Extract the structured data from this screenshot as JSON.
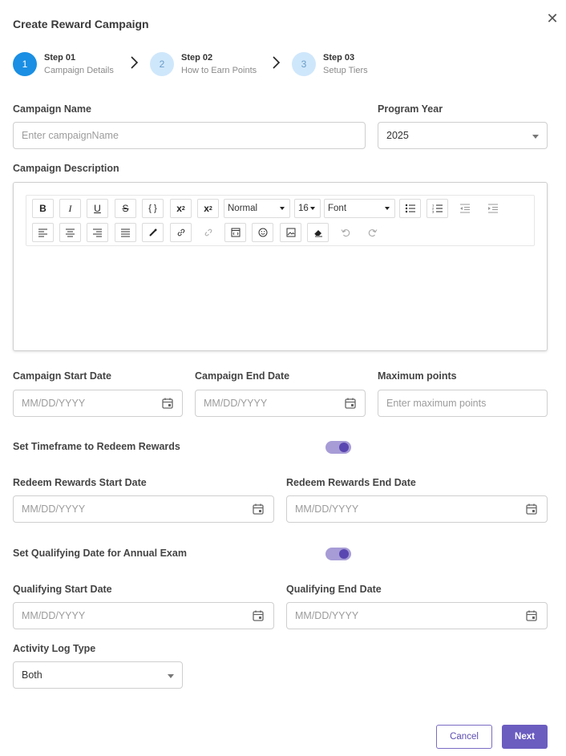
{
  "header": {
    "title": "Create Reward Campaign"
  },
  "steps": [
    {
      "number": "1",
      "title": "Step 01",
      "subtitle": "Campaign Details"
    },
    {
      "number": "2",
      "title": "Step 02",
      "subtitle": "How to Earn Points"
    },
    {
      "number": "3",
      "title": "Step 03",
      "subtitle": "Setup Tiers"
    }
  ],
  "form": {
    "campaign_name": {
      "label": "Campaign Name",
      "placeholder": "Enter campaignName"
    },
    "program_year": {
      "label": "Program Year",
      "value": "2025"
    },
    "description": {
      "label": "Campaign Description",
      "toolbar": {
        "heading_select": "Normal",
        "size_select": "16",
        "font_select": "Font"
      }
    },
    "start_date": {
      "label": "Campaign Start Date",
      "placeholder": "MM/DD/YYYY"
    },
    "end_date": {
      "label": "Campaign End Date",
      "placeholder": "MM/DD/YYYY"
    },
    "max_points": {
      "label": "Maximum points",
      "placeholder": "Enter maximum points"
    },
    "redeem_toggle": {
      "label": "Set Timeframe to Redeem Rewards",
      "on": true
    },
    "redeem_start": {
      "label": "Redeem Rewards Start Date",
      "placeholder": "MM/DD/YYYY"
    },
    "redeem_end": {
      "label": "Redeem Rewards End Date",
      "placeholder": "MM/DD/YYYY"
    },
    "qualifying_toggle": {
      "label": "Set Qualifying Date for Annual Exam",
      "on": true
    },
    "qualifying_start": {
      "label": "Qualifying Start Date",
      "placeholder": "MM/DD/YYYY"
    },
    "qualifying_end": {
      "label": "Qualifying End Date",
      "placeholder": "MM/DD/YYYY"
    },
    "activity_log": {
      "label": "Activity Log Type",
      "value": "Both"
    }
  },
  "footer": {
    "cancel_label": "Cancel",
    "next_label": "Next"
  },
  "colors": {
    "accent": "#6b5dc0",
    "step_active": "#1a8fe3",
    "toggle_track": "#a79cd6"
  }
}
